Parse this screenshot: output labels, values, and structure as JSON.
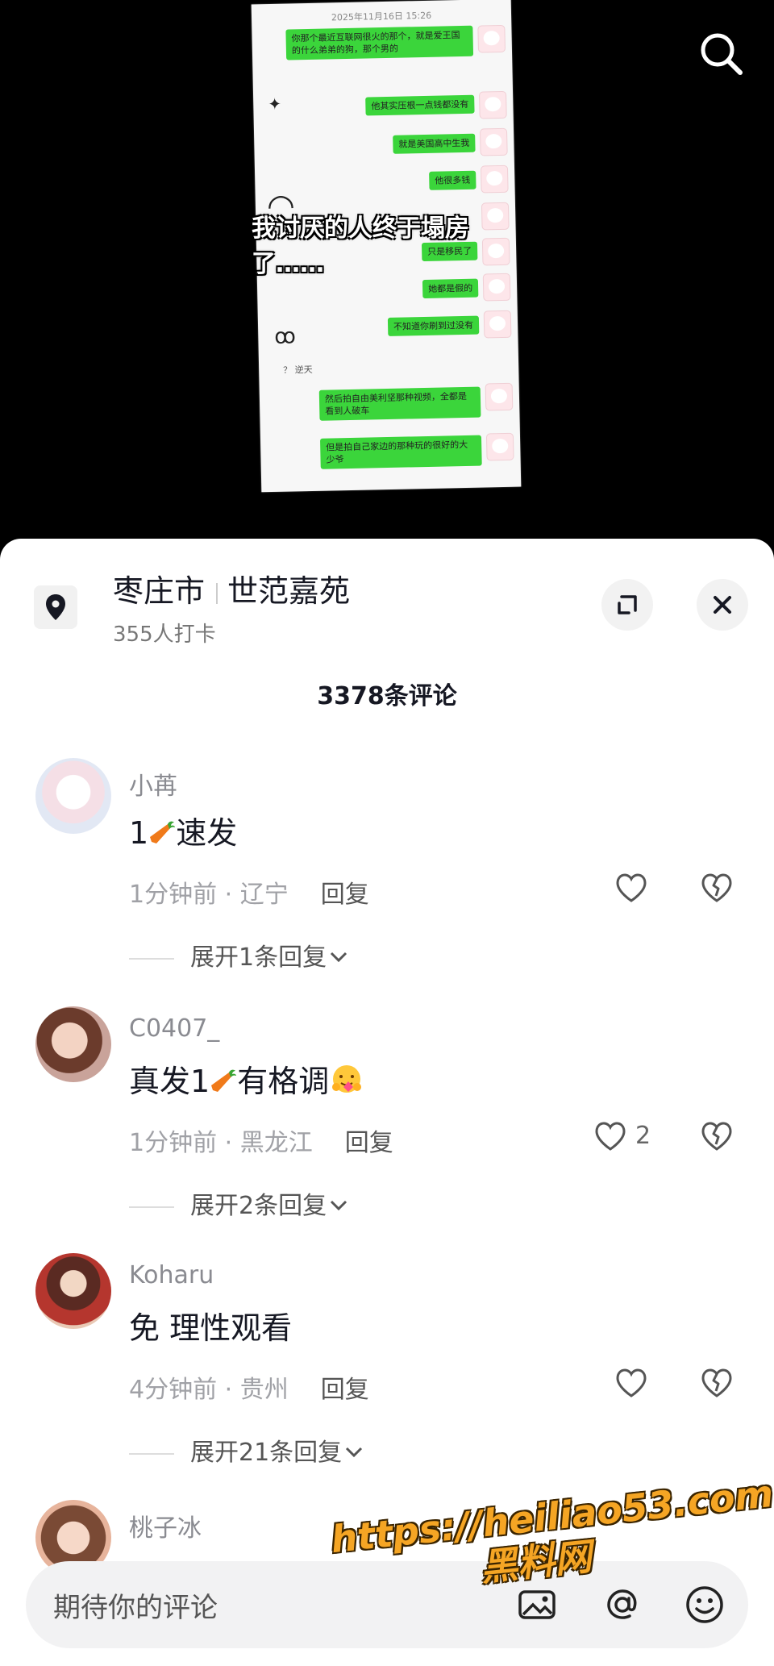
{
  "video": {
    "screenshot": {
      "timestamp": "2025年11月16日 15:26",
      "messages": [
        "你那个最近互联网很火的那个，就是爱王国的什么弟弟的狗，那个男的",
        "他其实压根一点钱都没有",
        "就是美国高中生我",
        "他很多钱",
        "只是移民了",
        "她都是假的",
        "不知道你刷到过没有",
        "然后拍自由美利坚那种视频，全都是看到人破车",
        "但是拍自己家边的那种玩的很好的大少爷"
      ],
      "system_note": "？ 逆天"
    },
    "caption": "我讨厌的人终于塌房了……"
  },
  "location": {
    "city": "枣庄市",
    "place": "世范嘉苑",
    "checkins": "355人打卡"
  },
  "comments_title": "3378条评论",
  "comments": [
    {
      "user": "小苒",
      "text_a": "1",
      "text_b": "速发",
      "time_region": "1分钟前 · 辽宁",
      "reply": "回复",
      "likes": "",
      "expand": "展开1条回复"
    },
    {
      "user": "C0407_",
      "text_a": "真发1",
      "text_b": "有格调",
      "time_region": "1分钟前 · 黑龙江",
      "reply": "回复",
      "likes": "2",
      "expand": "展开2条回复"
    },
    {
      "user": "Koharu",
      "text_a": "免 理性观看",
      "text_b": "",
      "time_region": "4分钟前 · 贵州",
      "reply": "回复",
      "likes": "",
      "expand": "展开21条回复"
    },
    {
      "user": "桃子冰",
      "text_a": "",
      "text_b": "",
      "time_region": "",
      "reply": "",
      "likes": "",
      "expand": ""
    }
  ],
  "input": {
    "placeholder": "期待你的评论"
  },
  "watermark": {
    "line1": "https://heiliao53.com",
    "line2": "黑料网"
  },
  "colors": {
    "accent_green": "#3bd53b",
    "watermark": "#f5a524"
  }
}
